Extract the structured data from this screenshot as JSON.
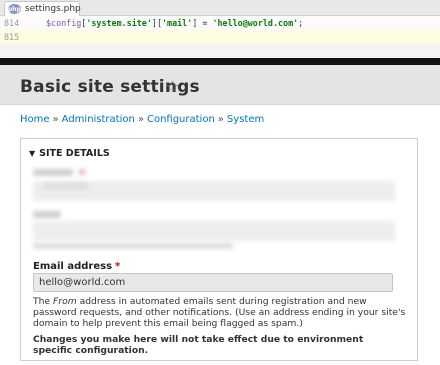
{
  "editor": {
    "tab_label": "settings.php",
    "tab_icon": "php-file-icon",
    "lines": [
      {
        "number": "814",
        "var": "$config",
        "key1": "'system.site'",
        "key2": "'mail'",
        "value": "'hello@world.com'"
      },
      {
        "number": "815"
      }
    ]
  },
  "page": {
    "title": "Basic site settings",
    "shortcut_icon": "star-icon"
  },
  "breadcrumb": [
    "Home",
    "Administration",
    "Configuration",
    "System"
  ],
  "details": {
    "summary": "SITE DETAILS",
    "email_label": "Email address",
    "email_required": "*",
    "email_value": "hello@world.com",
    "help_prefix": "The ",
    "help_em": "From",
    "help_rest": " address in automated emails sent during registration and new password requests, and other notifications. (Use an address ending in your site's domain to help prevent this email being flagged as spam.)",
    "warning": "Changes you make here will not take effect due to environment specific configuration."
  }
}
